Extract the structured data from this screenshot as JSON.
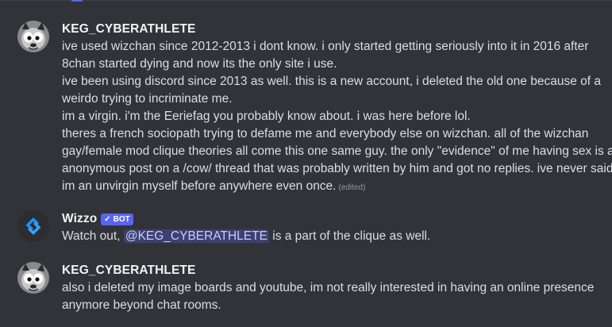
{
  "colors": {
    "background": "#313338",
    "username": "#f2f3f5",
    "text": "#dbdee1",
    "muted": "#949ba4",
    "brand": "#5865f2",
    "mention_bg": "#3c4270",
    "mention_text": "#c9cdfb"
  },
  "messages": [
    {
      "author": "KEG_CYBERATHLETE",
      "avatar_icon": "cartoon-possum-avatar-icon",
      "lines": [
        "ive used wizchan since 2012-2013 i dont know. i only started getting seriously into it in 2016 after",
        "8chan started dying and now its the only site i use.",
        "ive been using discord since 2013 as well. this is a new account, i deleted the old one because of a",
        "weirdo trying to incriminate me.",
        "im a virgin. i'm the Eeriefag you probably know about. i was here before lol.",
        "theres a french sociopath trying to defame me and everybody else on wizchan. all of the wizchan",
        "gay/female mod clique theories all come this one same guy. the only \"evidence\" of me having sex is an",
        "anonymous post on a /cow/ thread that was probably written by him and got no replies. ive never said",
        "im an unvirgin myself before anywhere even once."
      ],
      "edited_label": "(edited)"
    },
    {
      "author": "Wizzo",
      "avatar_icon": "blue-diamond-bot-avatar-icon",
      "bot_tag_check": "✓",
      "bot_tag_label": "BOT",
      "text_before": "Watch out, ",
      "mention": "@KEG_CYBERATHLETE",
      "text_after": " is a part of the clique as well."
    },
    {
      "author": "KEG_CYBERATHLETE",
      "avatar_icon": "cartoon-possum-avatar-icon",
      "lines": [
        "also i deleted my image boards and youtube, im not really interested in having an online presence",
        "anymore beyond chat rooms."
      ]
    }
  ]
}
